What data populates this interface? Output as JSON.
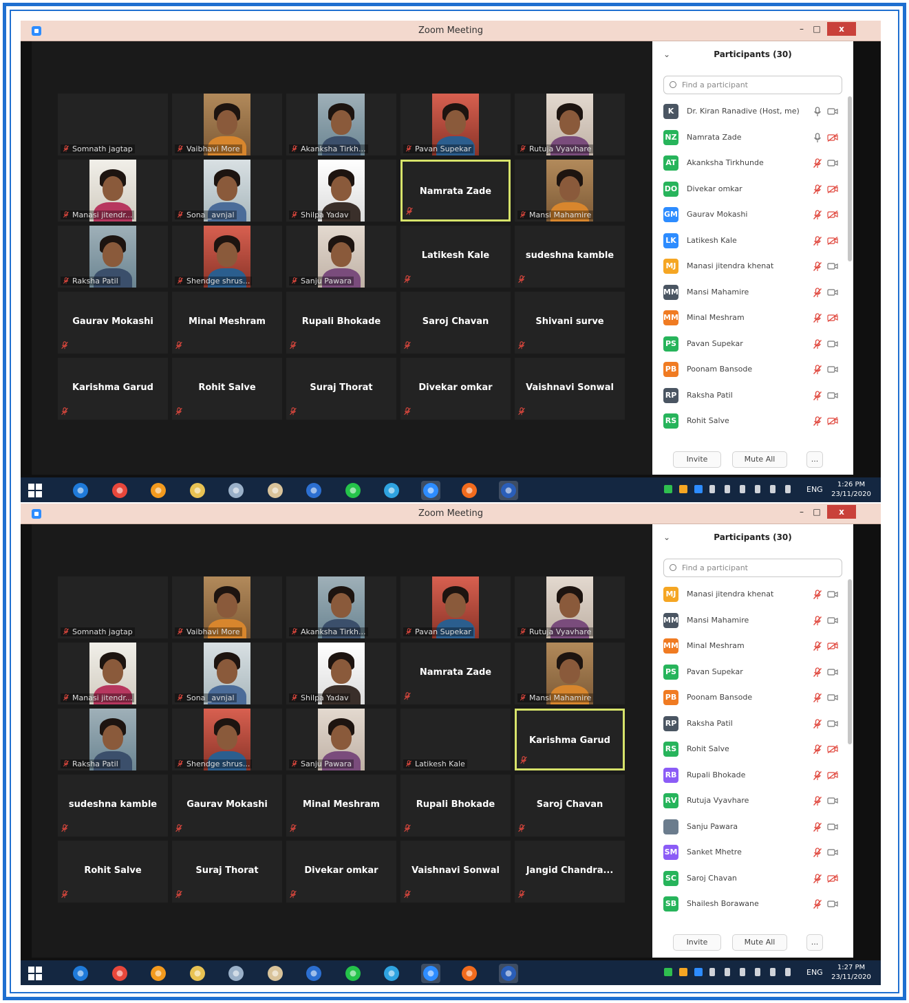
{
  "window": {
    "title": "Zoom Meeting",
    "minimize": "–",
    "maximize": "□",
    "close": "x"
  },
  "colors": {
    "frame": "#1e6fd0",
    "active_speaker_border": "#d7e36a",
    "taskbar": "#142741",
    "close_button": "#c9413a"
  },
  "shots": [
    {
      "id": "shot-1",
      "active_speaker": "Namrata Zade",
      "grid": [
        [
          {
            "name": "Somnath jagtap",
            "video": false,
            "label": "corner"
          },
          {
            "name": "Vaibhavi More",
            "video": true,
            "label": "corner"
          },
          {
            "name": "Akanksha Tirkh...",
            "video": true,
            "label": "corner"
          },
          {
            "name": "Pavan Supekar",
            "video": true,
            "label": "corner"
          },
          {
            "name": "Rutuja Vyavhare",
            "video": true,
            "label": "corner"
          }
        ],
        [
          {
            "name": "Manasi jitendr...",
            "video": true,
            "label": "corner"
          },
          {
            "name": "Sona _avnjal",
            "video": true,
            "label": "corner"
          },
          {
            "name": "Shilpa Yadav",
            "video": true,
            "label": "corner"
          },
          {
            "name": "Namrata Zade",
            "video": false,
            "label": "center",
            "active": true
          },
          {
            "name": "Mansi Mahamire",
            "video": true,
            "label": "corner"
          }
        ],
        [
          {
            "name": "Raksha Patil",
            "video": true,
            "label": "corner"
          },
          {
            "name": "Shendge shrus...",
            "video": true,
            "label": "corner"
          },
          {
            "name": "Sanju Pawara",
            "video": true,
            "label": "corner"
          },
          {
            "name": "Latikesh Kale",
            "video": false,
            "label": "center"
          },
          {
            "name": "sudeshna kamble",
            "video": false,
            "label": "center"
          }
        ],
        [
          {
            "name": "Gaurav Mokashi",
            "video": false,
            "label": "center"
          },
          {
            "name": "Minal Meshram",
            "video": false,
            "label": "center"
          },
          {
            "name": "Rupali Bhokade",
            "video": false,
            "label": "center"
          },
          {
            "name": "Saroj Chavan",
            "video": false,
            "label": "center"
          },
          {
            "name": "Shivani surve",
            "video": false,
            "label": "center"
          }
        ],
        [
          {
            "name": "Karishma Garud",
            "video": false,
            "label": "center"
          },
          {
            "name": "Rohit Salve",
            "video": false,
            "label": "center"
          },
          {
            "name": "Suraj Thorat",
            "video": false,
            "label": "center"
          },
          {
            "name": "Divekar omkar",
            "video": false,
            "label": "center"
          },
          {
            "name": "Vaishnavi Sonwal",
            "video": false,
            "label": "center"
          }
        ]
      ],
      "participants": {
        "header": "Participants (30)",
        "search_placeholder": "Find a participant",
        "rows": [
          {
            "initials": "K",
            "name": "Dr. Kiran Ranadive (Host, me)",
            "color": "#4a5562",
            "mic_muted": false,
            "cam_off": false
          },
          {
            "initials": "NZ",
            "name": "Namrata Zade",
            "color": "#27b45b",
            "mic_muted": false,
            "cam_off": true
          },
          {
            "initials": "AT",
            "name": "Akanksha Tirkhunde",
            "color": "#27b45b",
            "mic_muted": true,
            "cam_off": false
          },
          {
            "initials": "DO",
            "name": "Divekar omkar",
            "color": "#27b45b",
            "mic_muted": true,
            "cam_off": true
          },
          {
            "initials": "GM",
            "name": "Gaurav Mokashi",
            "color": "#2d8cff",
            "mic_muted": true,
            "cam_off": true
          },
          {
            "initials": "LK",
            "name": "Latikesh Kale",
            "color": "#2d8cff",
            "mic_muted": true,
            "cam_off": true
          },
          {
            "initials": "MJ",
            "name": "Manasi jitendra khenat",
            "color": "#f5a623",
            "mic_muted": true,
            "cam_off": false
          },
          {
            "initials": "MM",
            "name": "Mansi Mahamire",
            "color": "#4a5562",
            "mic_muted": true,
            "cam_off": false
          },
          {
            "initials": "MM",
            "name": "Minal Meshram",
            "color": "#f07b22",
            "mic_muted": true,
            "cam_off": true
          },
          {
            "initials": "PS",
            "name": "Pavan Supekar",
            "color": "#27b45b",
            "mic_muted": true,
            "cam_off": false
          },
          {
            "initials": "PB",
            "name": "Poonam Bansode",
            "color": "#f07b22",
            "mic_muted": true,
            "cam_off": false
          },
          {
            "initials": "RP",
            "name": "Raksha Patil",
            "color": "#4a5562",
            "mic_muted": true,
            "cam_off": false
          },
          {
            "initials": "RS",
            "name": "Rohit Salve",
            "color": "#27b45b",
            "mic_muted": true,
            "cam_off": true
          }
        ],
        "invite": "Invite",
        "mute_all": "Mute All",
        "more": "..."
      },
      "taskbar": {
        "lang": "ENG",
        "time": "1:26 PM",
        "date": "23/11/2020"
      }
    },
    {
      "id": "shot-2",
      "active_speaker": "Karishma Garud",
      "grid": [
        [
          {
            "name": "Somnath jagtap",
            "video": false,
            "label": "corner"
          },
          {
            "name": "Vaibhavi More",
            "video": true,
            "label": "corner"
          },
          {
            "name": "Akanksha Tirkh...",
            "video": true,
            "label": "corner"
          },
          {
            "name": "Pavan Supekar",
            "video": true,
            "label": "corner"
          },
          {
            "name": "Rutuja Vyavhare",
            "video": true,
            "label": "corner"
          }
        ],
        [
          {
            "name": "Manasi jitendr...",
            "video": true,
            "label": "corner"
          },
          {
            "name": "Sona _avnjal",
            "video": true,
            "label": "corner"
          },
          {
            "name": "Shilpa Yadav",
            "video": true,
            "label": "corner"
          },
          {
            "name": "Namrata Zade",
            "video": false,
            "label": "center"
          },
          {
            "name": "Mansi Mahamire",
            "video": true,
            "label": "corner"
          }
        ],
        [
          {
            "name": "Raksha Patil",
            "video": true,
            "label": "corner"
          },
          {
            "name": "Shendge shrus...",
            "video": true,
            "label": "corner"
          },
          {
            "name": "Sanju Pawara",
            "video": true,
            "label": "corner"
          },
          {
            "name": "Latikesh Kale",
            "video": false,
            "label": "corner"
          },
          {
            "name": "Karishma Garud",
            "video": false,
            "label": "center",
            "active": true
          }
        ],
        [
          {
            "name": "sudeshna kamble",
            "video": false,
            "label": "center"
          },
          {
            "name": "Gaurav Mokashi",
            "video": false,
            "label": "center"
          },
          {
            "name": "Minal Meshram",
            "video": false,
            "label": "center"
          },
          {
            "name": "Rupali Bhokade",
            "video": false,
            "label": "center"
          },
          {
            "name": "Saroj Chavan",
            "video": false,
            "label": "center"
          }
        ],
        [
          {
            "name": "Rohit Salve",
            "video": false,
            "label": "center"
          },
          {
            "name": "Suraj Thorat",
            "video": false,
            "label": "center"
          },
          {
            "name": "Divekar omkar",
            "video": false,
            "label": "center"
          },
          {
            "name": "Vaishnavi Sonwal",
            "video": false,
            "label": "center"
          },
          {
            "name": "Jangid Chandra...",
            "video": false,
            "label": "center"
          }
        ]
      ],
      "participants": {
        "header": "Participants (30)",
        "search_placeholder": "Find a participant",
        "rows": [
          {
            "initials": "MJ",
            "name": "Manasi jitendra khenat",
            "color": "#f5a623",
            "mic_muted": true,
            "cam_off": false
          },
          {
            "initials": "MM",
            "name": "Mansi Mahamire",
            "color": "#4a5562",
            "mic_muted": true,
            "cam_off": false
          },
          {
            "initials": "MM",
            "name": "Minal Meshram",
            "color": "#f07b22",
            "mic_muted": true,
            "cam_off": true
          },
          {
            "initials": "PS",
            "name": "Pavan Supekar",
            "color": "#27b45b",
            "mic_muted": true,
            "cam_off": false
          },
          {
            "initials": "PB",
            "name": "Poonam Bansode",
            "color": "#f07b22",
            "mic_muted": true,
            "cam_off": false
          },
          {
            "initials": "RP",
            "name": "Raksha Patil",
            "color": "#4a5562",
            "mic_muted": true,
            "cam_off": false
          },
          {
            "initials": "RS",
            "name": "Rohit Salve",
            "color": "#27b45b",
            "mic_muted": true,
            "cam_off": true
          },
          {
            "initials": "RB",
            "name": "Rupali Bhokade",
            "color": "#8b5cf6",
            "mic_muted": true,
            "cam_off": true
          },
          {
            "initials": "RV",
            "name": "Rutuja Vyavhare",
            "color": "#27b45b",
            "mic_muted": true,
            "cam_off": false
          },
          {
            "initials": "",
            "name": "Sanju Pawara",
            "color": "#6b7c8d",
            "mic_muted": true,
            "cam_off": false
          },
          {
            "initials": "SM",
            "name": "Sanket Mhetre",
            "color": "#8b5cf6",
            "mic_muted": true,
            "cam_off": false
          },
          {
            "initials": "SC",
            "name": "Saroj Chavan",
            "color": "#27b45b",
            "mic_muted": true,
            "cam_off": true
          },
          {
            "initials": "SB",
            "name": "Shailesh Borawane",
            "color": "#27b45b",
            "mic_muted": true,
            "cam_off": false
          }
        ],
        "invite": "Invite",
        "mute_all": "Mute All",
        "more": "..."
      },
      "taskbar": {
        "lang": "ENG",
        "time": "1:27 PM",
        "date": "23/11/2020"
      }
    }
  ],
  "taskbar_apps": [
    {
      "icon": "internet-explorer-icon",
      "color": "#1f7ad9"
    },
    {
      "icon": "chrome-icon",
      "color": "#e8473b"
    },
    {
      "icon": "media-player-icon",
      "color": "#f39a1e"
    },
    {
      "icon": "file-explorer-icon",
      "color": "#e8c253"
    },
    {
      "icon": "calculator-icon",
      "color": "#9ab0c8"
    },
    {
      "icon": "paint-icon",
      "color": "#d9c39a"
    },
    {
      "icon": "photoshop-icon",
      "color": "#2c6fd1"
    },
    {
      "icon": "whatsapp-icon",
      "color": "#25c34a"
    },
    {
      "icon": "telegram-icon",
      "color": "#2fa3e0"
    },
    {
      "icon": "zoom-icon",
      "color": "#2d8cff",
      "active": true
    },
    {
      "icon": "firefox-icon",
      "color": "#f26b1d"
    },
    {
      "icon": "word-icon",
      "color": "#2a5eb8",
      "active": true
    }
  ]
}
